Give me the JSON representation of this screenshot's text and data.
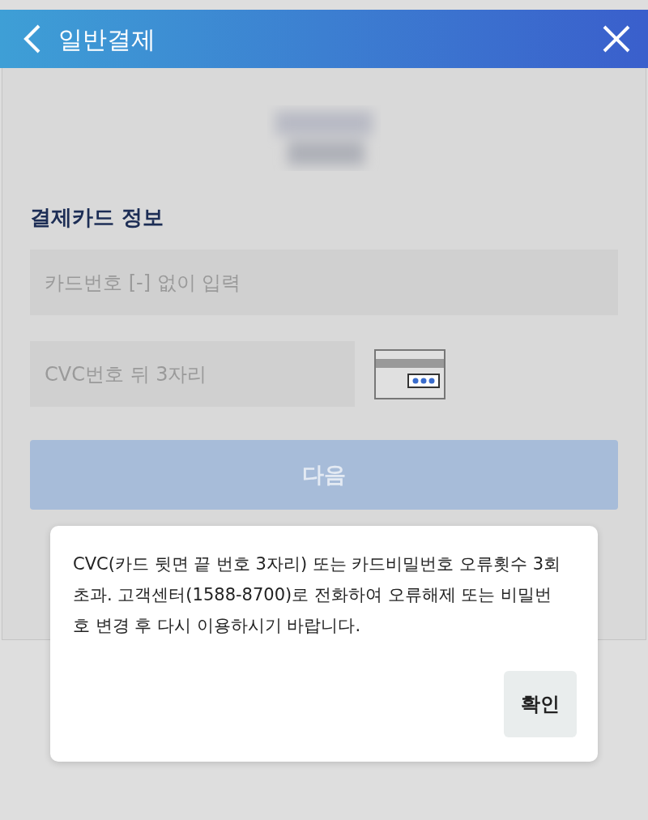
{
  "header": {
    "title": "일반결제"
  },
  "section": {
    "heading": "결제카드 정보"
  },
  "fields": [
    {
      "placeholder": "카드번호 [-] 없이 입력"
    },
    {
      "placeholder": "CVC번호 뒤 3자리"
    }
  ],
  "next_button": {
    "label": "다음",
    "disabled": true
  },
  "dialog": {
    "message": "CVC(카드 뒷면 끝 번호 3자리) 또는 카드비밀번호 오류횟수 3회 초과. 고객센터(1588-8700)로 전화하여 오류해제 또는 비밀번호 변경 후 다시 이용하시기 바랍니다.",
    "button": "확인"
  }
}
